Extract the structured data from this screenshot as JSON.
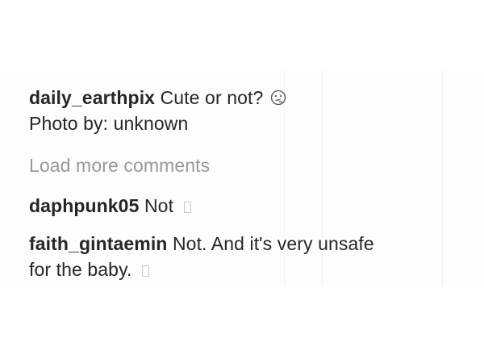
{
  "post": {
    "caption": {
      "username": "daily_earthpix",
      "text": "Cute or not?",
      "emoji": "thinking-face-icon",
      "line2": "Photo by: unknown"
    },
    "load_more_label": "Load more comments",
    "comments": [
      {
        "username": "daphpunk05",
        "text": "Not",
        "emoji": "missing-glyph-icon"
      },
      {
        "username": "faith_gintaemin",
        "text": "Not. And it's very unsafe",
        "text_line2": "for the baby.",
        "emoji": "missing-glyph-icon"
      }
    ]
  },
  "colors": {
    "text": "#262626",
    "muted": "#999999",
    "background": "#ffffff"
  }
}
